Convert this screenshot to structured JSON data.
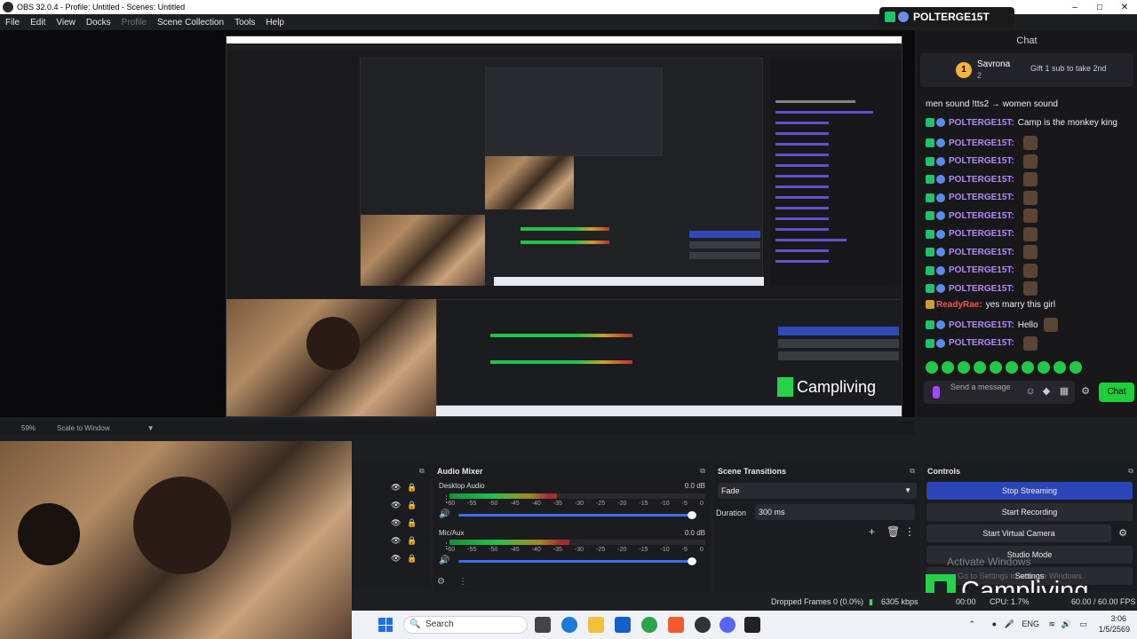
{
  "window": {
    "title": "OBS 32.0.4 - Profile: Untitled - Scenes: Untitled",
    "controls": [
      "–",
      "□",
      "✕"
    ]
  },
  "menu": [
    "File",
    "Edit",
    "View",
    "Docks",
    "Profile",
    "Scene Collection",
    "Tools",
    "Help"
  ],
  "preview": {
    "zoom": "59%",
    "scale_mode": "Scale to Window",
    "overlay_text": "Campliving"
  },
  "streamer_tag": "POLTERGE15T",
  "chat": {
    "title": "Chat",
    "pinned": {
      "rank": "1",
      "user": "Savrona",
      "count": "2",
      "message": "Gift 1 sub to take 2nd"
    },
    "lines": [
      {
        "user": "",
        "text": "men sound !tts2 → women sound",
        "plain": true
      },
      {
        "user": "POLTERGE15T:",
        "text": "Camp is the monkey king"
      },
      {
        "user": "POLTERGE15T:",
        "text": "",
        "emote": true
      },
      {
        "user": "POLTERGE15T:",
        "text": "",
        "emote": true
      },
      {
        "user": "POLTERGE15T:",
        "text": "",
        "emote": true
      },
      {
        "user": "POLTERGE15T:",
        "text": "",
        "emote": true
      },
      {
        "user": "POLTERGE15T:",
        "text": "",
        "emote": true
      },
      {
        "user": "POLTERGE15T:",
        "text": "",
        "emote": true
      },
      {
        "user": "POLTERGE15T:",
        "text": "",
        "emote": true
      },
      {
        "user": "POLTERGE15T:",
        "text": "",
        "emote": true
      },
      {
        "user": "POLTERGE15T:",
        "text": "",
        "emote": true
      },
      {
        "user": "ReadyRae:",
        "text": "yes marry this girl",
        "red": true
      },
      {
        "user": "POLTERGE15T:",
        "text": "Hello",
        "emote": true
      },
      {
        "user": "POLTERGE15T:",
        "text": "",
        "emote": true
      }
    ],
    "input_placeholder": "Send a message",
    "send_label": "Chat"
  },
  "docks": {
    "audio_mixer": {
      "title": "Audio Mixer",
      "channels": [
        {
          "name": "Desktop Audio",
          "db": "0.0 dB",
          "level": 0.42
        },
        {
          "name": "Mic/Aux",
          "db": "0.0 dB",
          "level": 0.47
        }
      ],
      "scale": [
        "-60",
        "-55",
        "-50",
        "-45",
        "-40",
        "-35",
        "-30",
        "-25",
        "-20",
        "-15",
        "-10",
        "-5",
        "0"
      ]
    },
    "scene_transitions": {
      "title": "Scene Transitions",
      "transition": "Fade",
      "duration_label": "Duration",
      "duration": "300 ms"
    },
    "controls": {
      "title": "Controls",
      "stop_streaming": "Stop Streaming",
      "start_recording": "Start Recording",
      "start_virtual_camera": "Start Virtual Camera",
      "studio_mode": "Studio Mode",
      "settings": "Settings"
    },
    "watermark": {
      "line1": "Activate Windows",
      "line2": "Go to Settings to activate Windows."
    }
  },
  "status": {
    "dropped_frames": "Dropped Frames 0 (0.0%)",
    "bitrate": "6305 kbps",
    "cpu": "CPU: 1.7%",
    "fps": "60.00 / 60.00 FPS",
    "time_partial": "00:00"
  },
  "taskbar": {
    "search": "Search",
    "lang": "ENG",
    "time": "3:06",
    "date": "1/5/2569"
  },
  "colors": {
    "accent_blue": "#2b44b8",
    "meter_green": "#22c24a",
    "chat_send": "#1dcf3a",
    "chat_user": "#b388ff"
  }
}
